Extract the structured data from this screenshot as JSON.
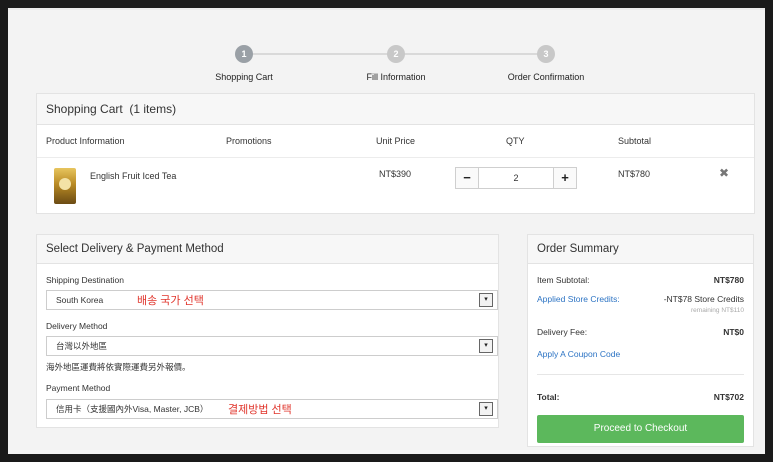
{
  "stepper": {
    "steps": [
      {
        "num": "1",
        "label": "Shopping Cart"
      },
      {
        "num": "2",
        "label": "Fill Information"
      },
      {
        "num": "3",
        "label": "Order Confirmation"
      }
    ],
    "active_step": 1
  },
  "cart": {
    "title": "Shopping Cart",
    "count": "(1 items)",
    "columns": {
      "product": "Product Information",
      "promotions": "Promotions",
      "unit_price": "Unit Price",
      "qty": "QTY",
      "subtotal": "Subtotal"
    },
    "items": [
      {
        "name": "English Fruit Iced Tea",
        "unit_price": "NT$390",
        "qty": "2",
        "subtotal": "NT$780",
        "minus": "−",
        "plus": "+",
        "remove": "✖"
      }
    ]
  },
  "delivery": {
    "title": "Select Delivery & Payment Method",
    "shipping_label": "Shipping Destination",
    "shipping_value": "South Korea",
    "shipping_annotation": "배송 국가 선택",
    "method_label": "Delivery Method",
    "method_value": "台灣以外地區",
    "method_note": "海外地區運費將依實際運費另外報價。",
    "payment_label": "Payment Method",
    "payment_value": "信用卡（支援國內外Visa, Master, JCB）",
    "payment_annotation": "결제방법 선택",
    "caret": "▾"
  },
  "summary": {
    "title": "Order Summary",
    "item_subtotal_label": "Item Subtotal:",
    "item_subtotal_value": "NT$780",
    "credits_label": "Applied Store Credits:",
    "credits_value": "-NT$78 Store Credits",
    "credits_remaining": "remaining NT$110",
    "delivery_fee_label": "Delivery Fee:",
    "delivery_fee_value": "NT$0",
    "coupon_link": "Apply A Coupon Code",
    "total_label": "Total:",
    "total_value": "NT$702",
    "checkout_button": "Proceed to Checkout"
  },
  "colors": {
    "accent_green": "#5cb85c",
    "link_blue": "#2d74c4",
    "annotation_red": "#e0342b"
  }
}
